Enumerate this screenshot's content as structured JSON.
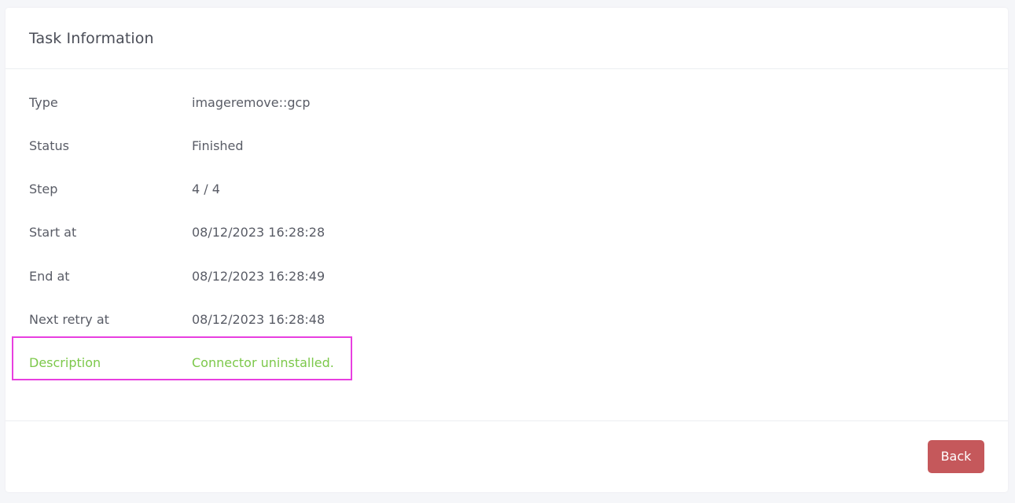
{
  "card": {
    "title": "Task Information"
  },
  "info": [
    {
      "label": "Type",
      "value": "imageremove::gcp"
    },
    {
      "label": "Status",
      "value": "Finished"
    },
    {
      "label": "Step",
      "value": "4 / 4"
    },
    {
      "label": "Start at",
      "value": "08/12/2023 16:28:28"
    },
    {
      "label": "End at",
      "value": "08/12/2023 16:28:49"
    },
    {
      "label": "Next retry at",
      "value": "08/12/2023 16:28:48"
    },
    {
      "label": "Description",
      "value": "Connector uninstalled."
    }
  ],
  "footer": {
    "back_label": "Back"
  },
  "colors": {
    "page_bg": "#f5f6f9",
    "text": "#595c66",
    "highlight_text": "#7cc84a",
    "highlight_border": "#e83fe0",
    "back_button": "#c5585b"
  }
}
